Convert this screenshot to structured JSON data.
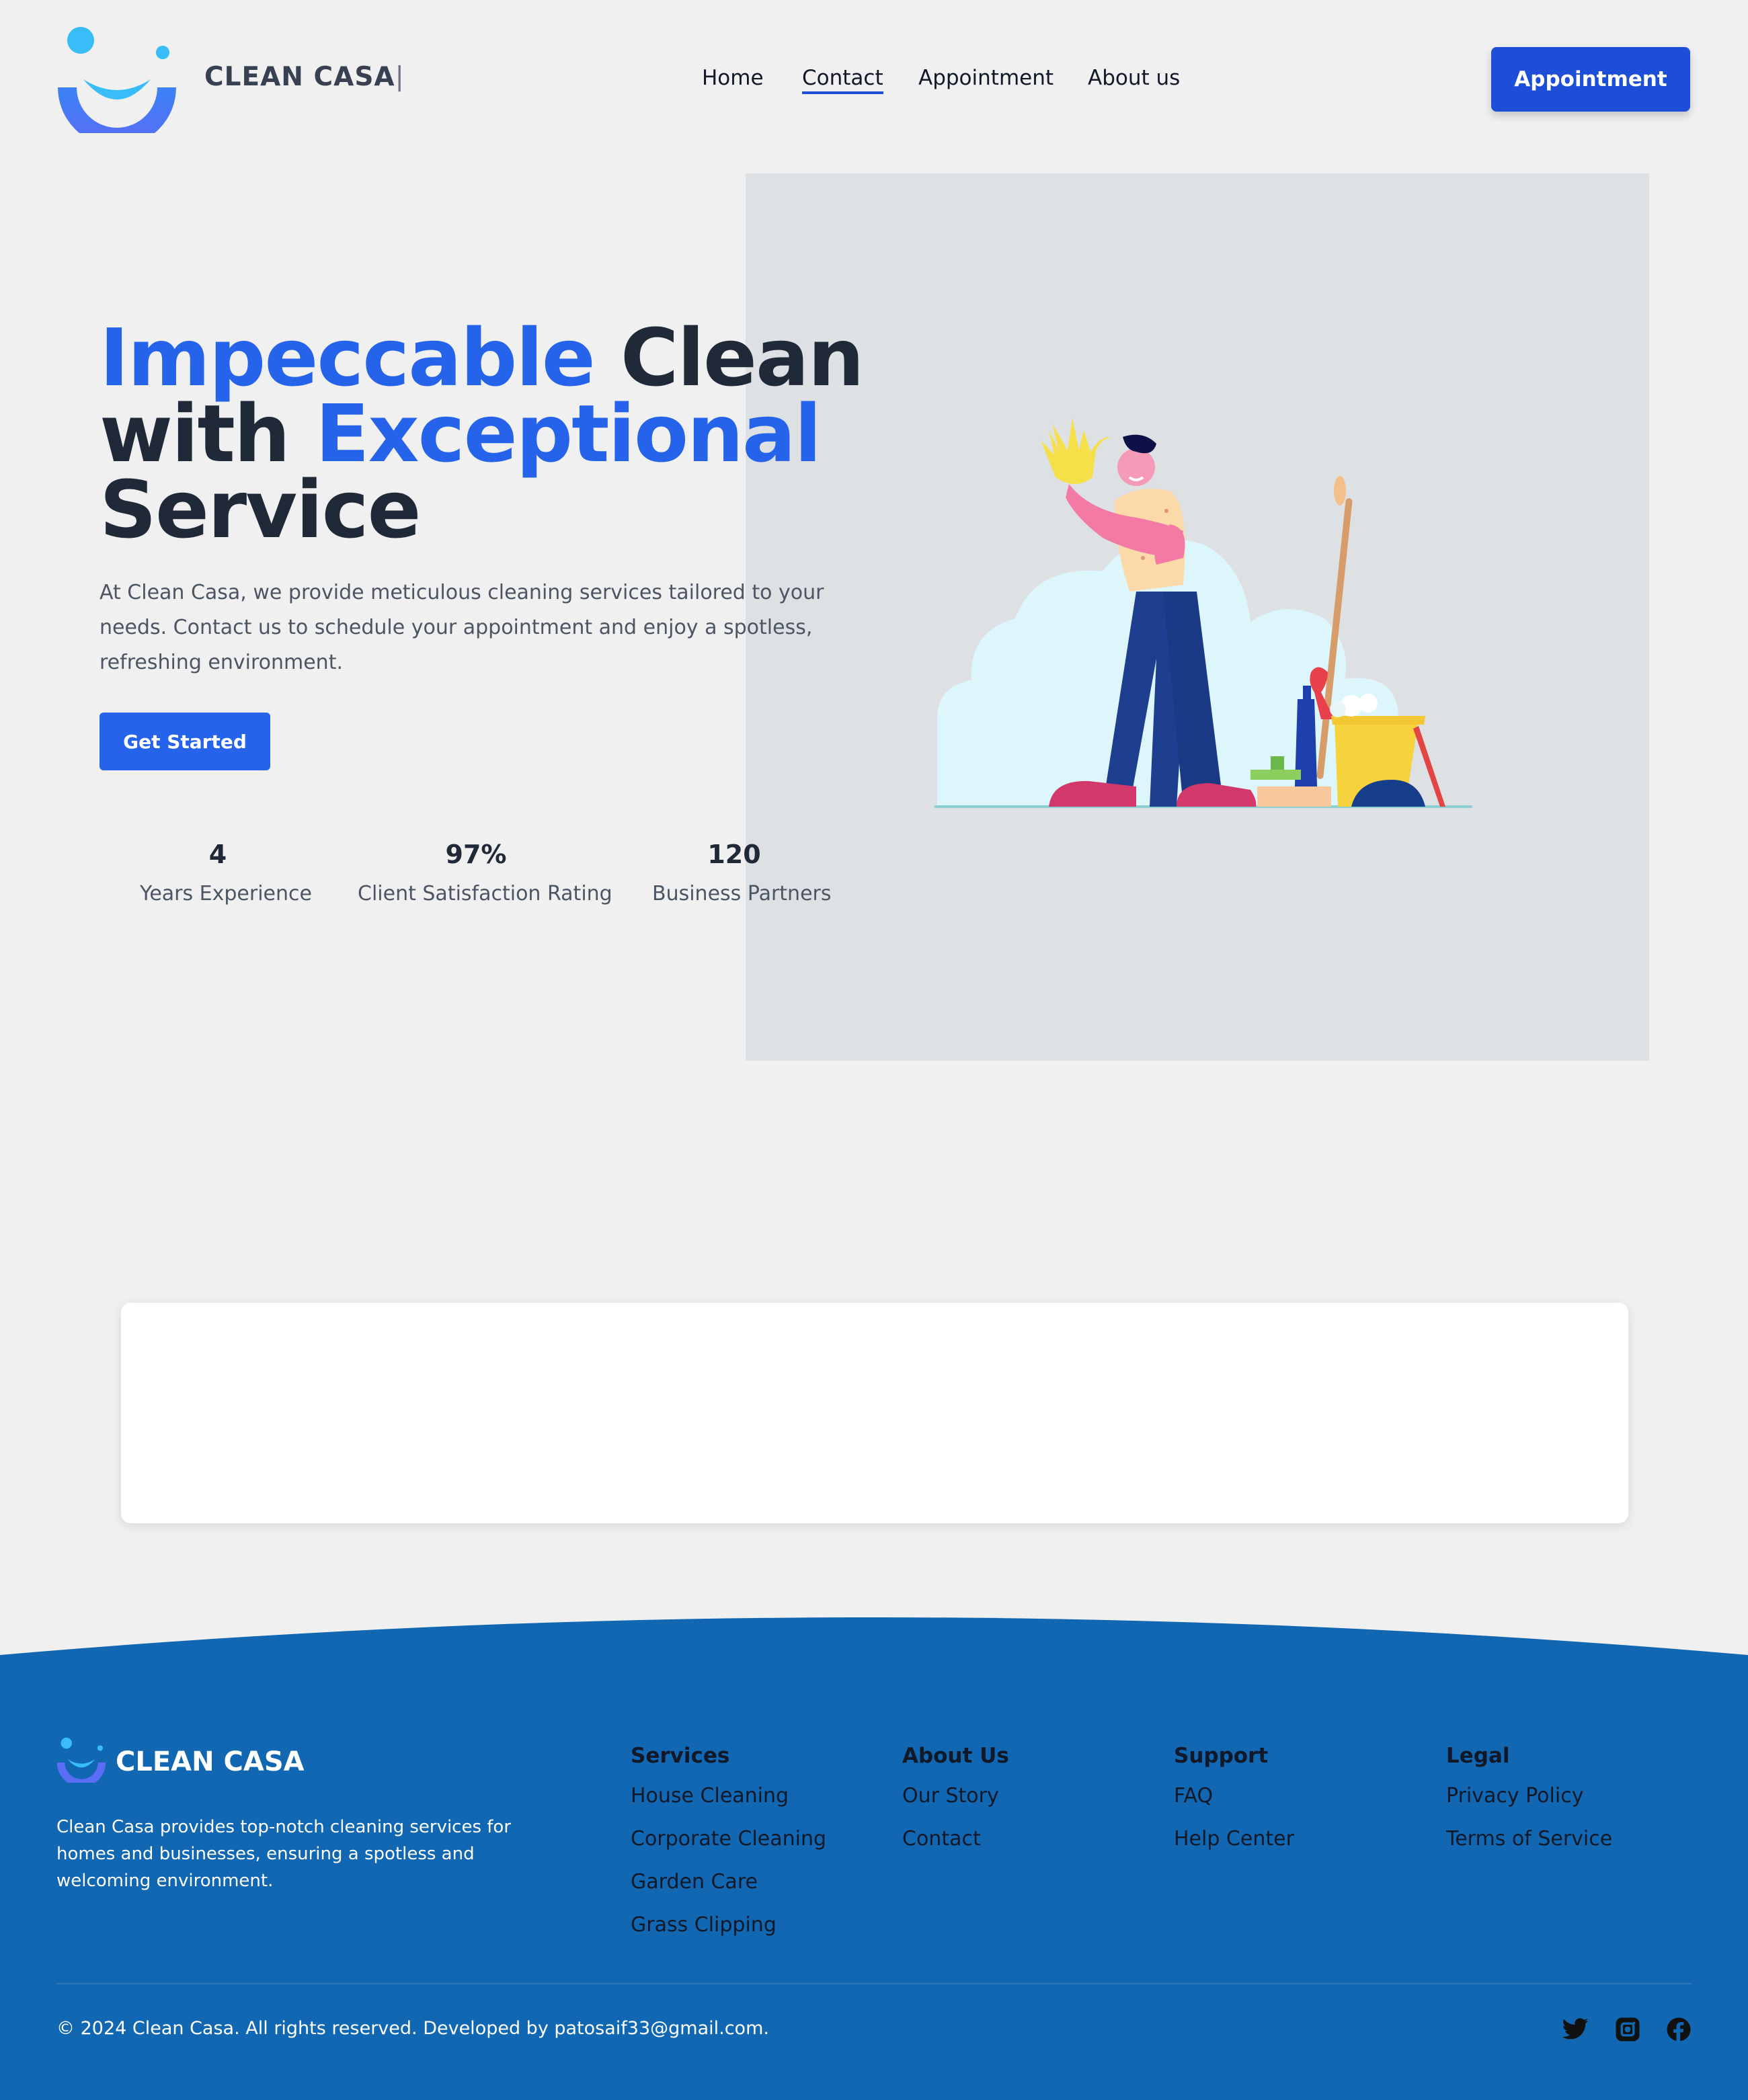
{
  "header": {
    "brand": "CLEAN CASA",
    "caret": "|",
    "nav": [
      "Home",
      "Contact",
      "Appointment",
      "About us"
    ],
    "active_nav": "Contact",
    "cta": "Appointment"
  },
  "hero": {
    "headline": {
      "w1": "Impeccable",
      "w2": " Clean",
      "w3": "with ",
      "w4": "Exceptional",
      "w5": "Service"
    },
    "description": "At Clean Casa, we provide meticulous cleaning services tailored to your needs. Contact us to schedule your appointment and enjoy a spotless, refreshing environment.",
    "cta": "Get Started",
    "stats": [
      {
        "value": "4",
        "label": "Years Experience"
      },
      {
        "value": "97%",
        "label": "Client Satisfaction Rating"
      },
      {
        "value": "120",
        "label": "Business Partners"
      }
    ]
  },
  "footer": {
    "brand": "CLEAN CASA",
    "description": "Clean Casa provides top-notch cleaning services for homes and businesses, ensuring a spotless and welcoming environment.",
    "columns": [
      {
        "title": "Services",
        "links": [
          "House Cleaning",
          "Corporate Cleaning",
          "Garden Care",
          "Grass Clipping"
        ]
      },
      {
        "title": "About Us",
        "links": [
          "Our Story",
          "Contact"
        ]
      },
      {
        "title": "Support",
        "links": [
          "FAQ",
          "Help Center"
        ]
      },
      {
        "title": "Legal",
        "links": [
          "Privacy Policy",
          "Terms of Service"
        ]
      }
    ],
    "copyright": "© 2024 Clean Casa. All rights reserved. Developed by patosaif33@gmail.com.",
    "social_icons": [
      "twitter-icon",
      "instagram-icon",
      "facebook-icon"
    ]
  },
  "colors": {
    "primary": "#1d4ed8",
    "accent_blue": "#2563eb",
    "footer_bg": "#1167b1",
    "logo_light": "#38bdf8",
    "logo_dark": "#4f6ef7"
  }
}
